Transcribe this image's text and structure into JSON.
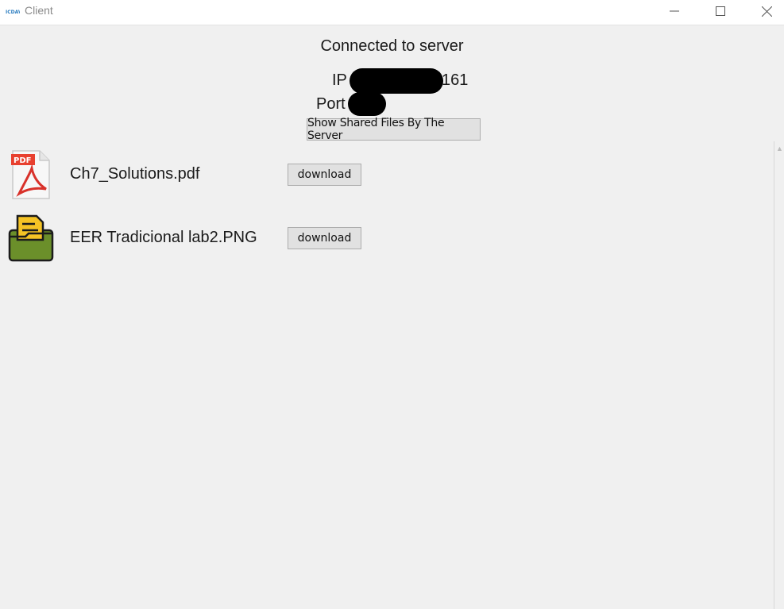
{
  "window": {
    "title": "Client"
  },
  "header": {
    "status": "Connected to server",
    "ip_label": "IP",
    "ip_suffix": "161",
    "port_label": "Port",
    "show_button_label": "Show Shared Files By The Server"
  },
  "files": [
    {
      "name": "Ch7_Solutions.pdf",
      "icon": "pdf-file-icon",
      "download_label": "download"
    },
    {
      "name": "EER Tradicional lab2.PNG",
      "icon": "folder-file-icon",
      "download_label": "download"
    }
  ]
}
